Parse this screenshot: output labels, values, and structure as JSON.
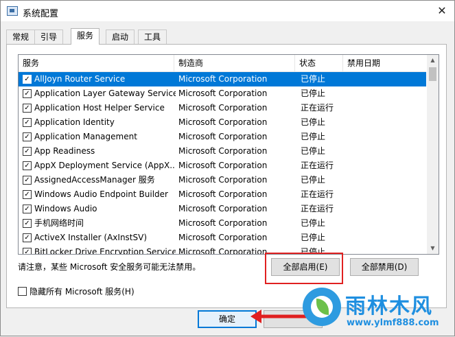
{
  "window": {
    "title": "系统配置",
    "close_glyph": "✕"
  },
  "tabs": [
    "常规",
    "引导",
    "服务",
    "启动",
    "工具"
  ],
  "active_tab": "服务",
  "columns": {
    "service": "服务",
    "manufacturer": "制造商",
    "status": "状态",
    "disabled_date": "禁用日期"
  },
  "services": [
    {
      "name": "AllJoyn Router Service",
      "manufacturer": "Microsoft Corporation",
      "status": "已停止",
      "checked": true,
      "selected": true
    },
    {
      "name": "Application Layer Gateway Service",
      "manufacturer": "Microsoft Corporation",
      "status": "已停止",
      "checked": true
    },
    {
      "name": "Application Host Helper Service",
      "manufacturer": "Microsoft Corporation",
      "status": "正在运行",
      "checked": true
    },
    {
      "name": "Application Identity",
      "manufacturer": "Microsoft Corporation",
      "status": "已停止",
      "checked": true
    },
    {
      "name": "Application Management",
      "manufacturer": "Microsoft Corporation",
      "status": "已停止",
      "checked": true
    },
    {
      "name": "App Readiness",
      "manufacturer": "Microsoft Corporation",
      "status": "已停止",
      "checked": true
    },
    {
      "name": "AppX Deployment Service (AppX...",
      "manufacturer": "Microsoft Corporation",
      "status": "正在运行",
      "checked": true
    },
    {
      "name": "AssignedAccessManager 服务",
      "manufacturer": "Microsoft Corporation",
      "status": "已停止",
      "checked": true
    },
    {
      "name": "Windows Audio Endpoint Builder",
      "manufacturer": "Microsoft Corporation",
      "status": "正在运行",
      "checked": true
    },
    {
      "name": "Windows Audio",
      "manufacturer": "Microsoft Corporation",
      "status": "正在运行",
      "checked": true
    },
    {
      "name": "手机网络时间",
      "manufacturer": "Microsoft Corporation",
      "status": "已停止",
      "checked": true
    },
    {
      "name": "ActiveX Installer (AxInstSV)",
      "manufacturer": "Microsoft Corporation",
      "status": "已停止",
      "checked": true
    },
    {
      "name": "BitLocker Drive Encryption Service",
      "manufacturer": "Microsoft Corporation",
      "status": "已停止",
      "checked": true
    }
  ],
  "note": "请注意，某些 Microsoft 安全服务可能无法禁用。",
  "buttons": {
    "enable_all": "全部启用(E)",
    "disable_all": "全部禁用(D)",
    "ok": "确定"
  },
  "hide_ms": {
    "label": "隐藏所有 Microsoft 服务(H)",
    "checked": false
  },
  "watermark": {
    "title": "雨林木风",
    "url": "www.ylmf888.com"
  },
  "colors": {
    "selection": "#0078d7",
    "highlight_box": "#e02020",
    "watermark": "#1f8fe0"
  }
}
